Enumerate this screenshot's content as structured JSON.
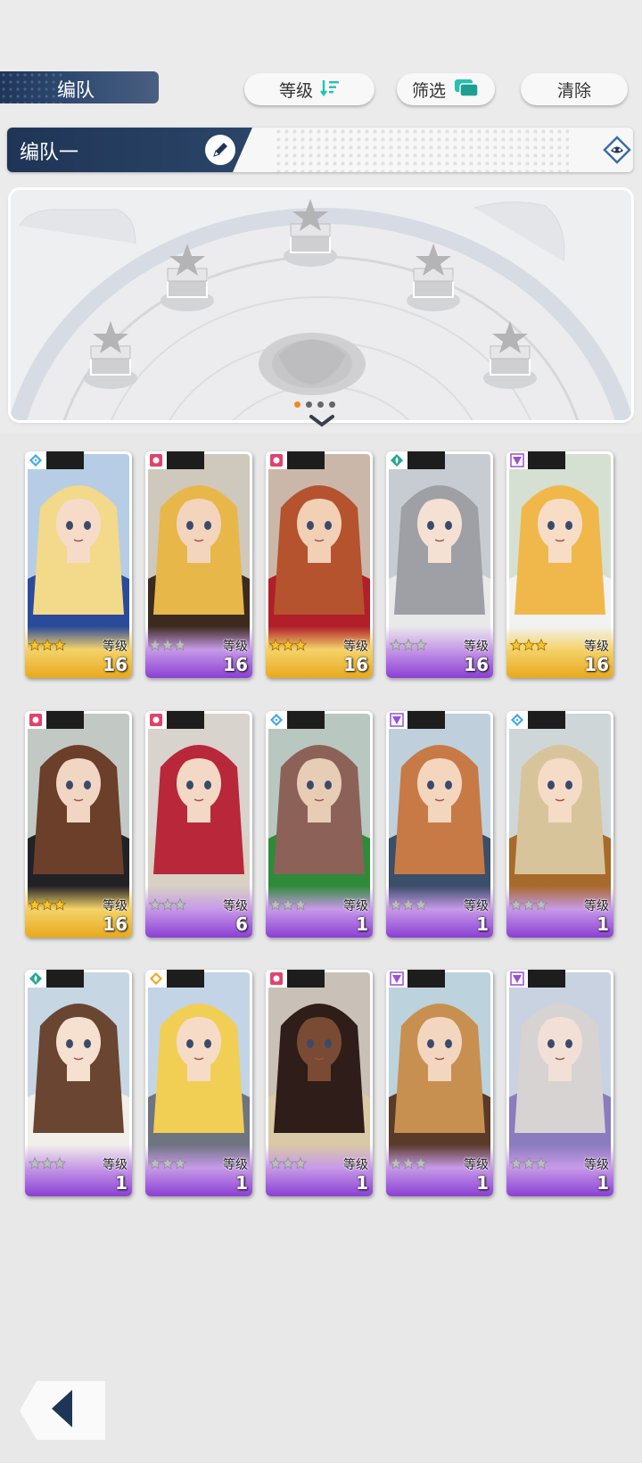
{
  "header": {
    "title": "编队",
    "sort_label": "等级",
    "filter_label": "筛选",
    "clear_label": "清除"
  },
  "team": {
    "name": "编队一",
    "page_count": 4,
    "active_page": 1
  },
  "colors": {
    "navy": "#203658",
    "gold_band": "#e8a91c",
    "purple_band": "#8b3fd3",
    "page_dot_active": "#f08a1f",
    "filter_icon": "#26c1b0"
  },
  "roster": {
    "level_label": "等级",
    "cards": [
      {
        "element": "ice",
        "stars": 3,
        "rarity": "gold",
        "level": "16"
      },
      {
        "element": "fire",
        "stars": 0,
        "rarity": "purple",
        "level": "16"
      },
      {
        "element": "fire",
        "stars": 3,
        "rarity": "gold",
        "level": "16"
      },
      {
        "element": "wind",
        "stars": 0,
        "rarity": "purple",
        "level": "16"
      },
      {
        "element": "light",
        "stars": 3,
        "rarity": "gold",
        "level": "16"
      },
      {
        "element": "fire",
        "stars": 3,
        "rarity": "gold",
        "level": "16"
      },
      {
        "element": "fire",
        "stars": 0,
        "rarity": "purple",
        "level": "6"
      },
      {
        "element": "ice",
        "stars": 0,
        "rarity": "purple",
        "level": "1"
      },
      {
        "element": "light",
        "stars": 0,
        "rarity": "purple",
        "level": "1"
      },
      {
        "element": "ice",
        "stars": 0,
        "rarity": "purple",
        "level": "1"
      },
      {
        "element": "wind",
        "stars": 0,
        "rarity": "purple",
        "level": "1"
      },
      {
        "element": "thunder",
        "stars": 0,
        "rarity": "purple",
        "level": "1"
      },
      {
        "element": "fire",
        "stars": 0,
        "rarity": "purple",
        "level": "1"
      },
      {
        "element": "light",
        "stars": 0,
        "rarity": "purple",
        "level": "1"
      },
      {
        "element": "light",
        "stars": 0,
        "rarity": "purple",
        "level": "1"
      }
    ]
  },
  "icons": {
    "sort": "sort-descending-icon",
    "filter": "filter-cards-icon",
    "edit": "pencil-icon",
    "emblem": "team-emblem-icon",
    "back": "back-arrow-icon"
  }
}
